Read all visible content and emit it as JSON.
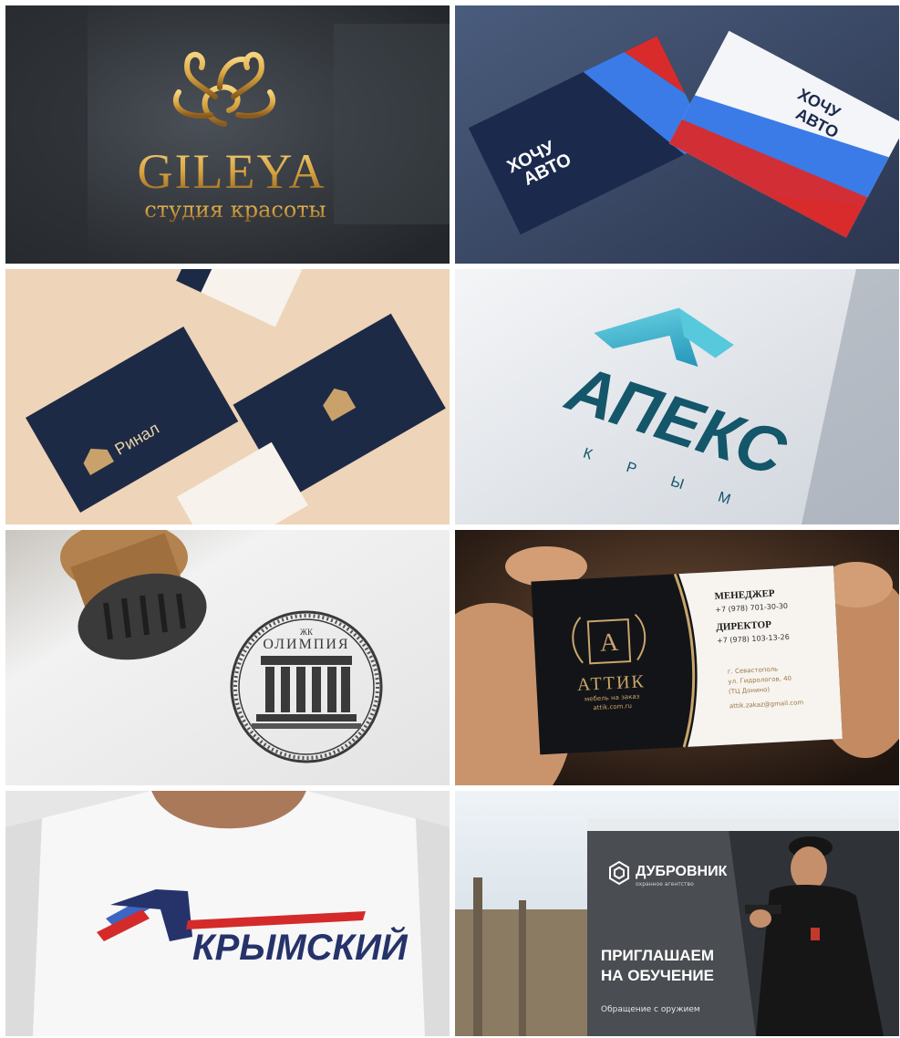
{
  "tiles": [
    {
      "id": "gileya",
      "brand": "GILEYA",
      "tagline": "студия красоты",
      "colors": {
        "bg": "#35383d",
        "gold": "#d9a441"
      }
    },
    {
      "id": "hochu-avto",
      "brand_top": "ХОЧУ",
      "brand_bottom": "АВТО",
      "colors": {
        "bg": "#3a4a66",
        "navy": "#1b2a4c",
        "blue": "#3a7be8",
        "red": "#d92b2b"
      }
    },
    {
      "id": "rinal",
      "brand": "Ринал",
      "colors": {
        "bg": "#eed4b8",
        "card": "#1d2a45",
        "gold": "#c9a26b"
      }
    },
    {
      "id": "apex",
      "brand": "АПЕКС",
      "sub": "К Р Ы М",
      "colors": {
        "bg": "#e9ecef",
        "teal": "#14566a",
        "aqua": "#3ec4d8"
      }
    },
    {
      "id": "olimpia",
      "brand": "ОЛИМПИЯ",
      "prefix": "ЖК",
      "colors": {
        "bg": "#eaeaea",
        "ink": "#3a3a3a",
        "wood": "#b3824e"
      }
    },
    {
      "id": "attik",
      "brand": "АТТИК",
      "subline": "мебель на заказ",
      "site": "attik.com.ru",
      "role1": "МЕНЕДЖЕР",
      "phone1": "+7 (978) 701-30-30",
      "role2": "ДИРЕКТОР",
      "phone2": "+7 (978) 103-13-26",
      "city": "г. Севастополь",
      "street": "ул. Гидрологов, 40",
      "mall": "(ТЦ Донино)",
      "email": "attik.zakaz@gmail.com",
      "colors": {
        "bg": "#2b1e17",
        "dark": "#121417",
        "gold": "#c9a56b"
      }
    },
    {
      "id": "krymsky",
      "brand": "КРЫМСКИЙ",
      "colors": {
        "bg": "#e6e6e6",
        "navy": "#26336b",
        "red": "#d42a2a",
        "blue": "#3b66c4"
      }
    },
    {
      "id": "dubrovnik",
      "brand": "ДУБРОВНИК",
      "brand_sub": "охранное агентство",
      "headline1": "ПРИГЛАШАЕМ",
      "headline2": "НА ОБУЧЕНИЕ",
      "caption": "Обращение с оружием",
      "colors": {
        "sky": "#dfe8ef",
        "panel": "#4a4d52",
        "panel_dark": "#2f3236"
      }
    }
  ]
}
